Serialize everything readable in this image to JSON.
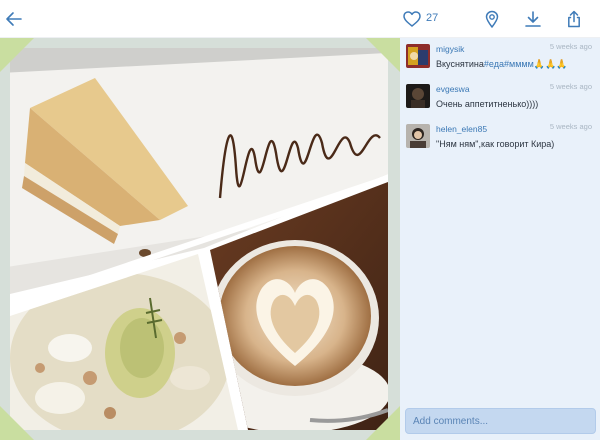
{
  "toolbar": {
    "likes_count": "27",
    "accent_color": "#3f7bb8",
    "icons": {
      "back": "arrow-left-icon",
      "like": "heart-icon",
      "location": "location-pin-icon",
      "download": "download-icon",
      "share": "share-icon"
    }
  },
  "photo": {
    "corner_color": "#c9dea0",
    "panels": [
      "dessert-cake",
      "latte-heart-art",
      "pasta-dish"
    ]
  },
  "comments": [
    {
      "username": "migysik",
      "time": "5 weeks ago",
      "text_parts": [
        "Вкуснятина",
        "#еда",
        "#мммм",
        "🙏🙏🙏"
      ]
    },
    {
      "username": "evgeswa",
      "time": "5 weeks ago",
      "text": "Очень аппетитненько))))"
    },
    {
      "username": "helen_elen85",
      "time": "5 weeks ago",
      "text": "\"Ням ням\",как говорит Кира)"
    }
  ],
  "composer": {
    "placeholder": "Add comments..."
  }
}
